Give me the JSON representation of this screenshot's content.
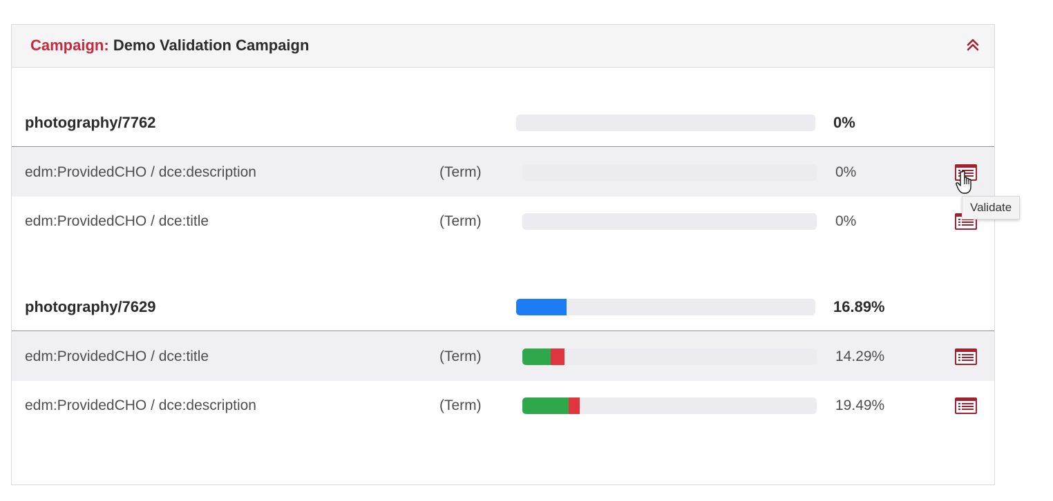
{
  "campaign": {
    "prefix": "Campaign:",
    "name": "Demo Validation Campaign"
  },
  "colors": {
    "accent": "#c8283b",
    "group_progress": "#1b7cf3",
    "validated": "#2ea84a",
    "rejected": "#e0343e",
    "track": "#ececf0"
  },
  "groups": [
    {
      "name": "photography/7762",
      "progress_percent": 0,
      "progress_label": "0%",
      "items": [
        {
          "path": "edm:ProvidedCHO / dce:description",
          "type": "(Term)",
          "green_percent": 0,
          "red_percent": 0,
          "progress_label": "0%",
          "icon": "validate-list-icon"
        },
        {
          "path": "edm:ProvidedCHO / dce:title",
          "type": "(Term)",
          "green_percent": 0,
          "red_percent": 0,
          "progress_label": "0%",
          "icon": "validate-list-icon"
        }
      ]
    },
    {
      "name": "photography/7629",
      "progress_percent": 16.89,
      "progress_label": "16.89%",
      "items": [
        {
          "path": "edm:ProvidedCHO / dce:title",
          "type": "(Term)",
          "green_percent": 9.6,
          "red_percent": 4.69,
          "progress_label": "14.29%",
          "icon": "validate-list-icon"
        },
        {
          "path": "edm:ProvidedCHO / dce:description",
          "type": "(Term)",
          "green_percent": 15.8,
          "red_percent": 3.69,
          "progress_label": "19.49%",
          "icon": "validate-list-icon"
        }
      ]
    }
  ],
  "tooltip": {
    "text": "Validate"
  }
}
